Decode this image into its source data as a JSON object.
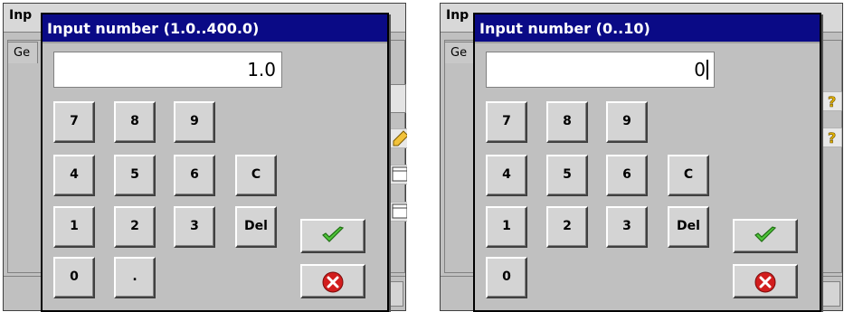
{
  "left": {
    "background_window": {
      "title": "Inp",
      "tab_label": "Ge"
    },
    "dialog": {
      "title": "Input number (1.0..400.0)",
      "display_value": "1.0",
      "keys": [
        "7",
        "8",
        "9",
        "4",
        "5",
        "6",
        "C",
        "1",
        "2",
        "3",
        "Del",
        "0",
        "."
      ],
      "ok_icon": "checkmark-icon",
      "cancel_icon": "cancel-x-icon"
    }
  },
  "right": {
    "background_window": {
      "title": "Inp",
      "tab_label": "Ge"
    },
    "dialog": {
      "title": "Input number (0..10)",
      "display_value": "0",
      "keys": [
        "7",
        "8",
        "9",
        "4",
        "5",
        "6",
        "C",
        "1",
        "2",
        "3",
        "Del",
        "0"
      ],
      "ok_icon": "checkmark-icon",
      "cancel_icon": "cancel-x-icon"
    }
  },
  "colors": {
    "dialog_title_bg": "#0a0a86",
    "dialog_title_text": "#ffffff",
    "dialog_bg": "#c0c0c0",
    "ok_check": "#2e9e22",
    "cancel_red": "#d21d1d"
  }
}
